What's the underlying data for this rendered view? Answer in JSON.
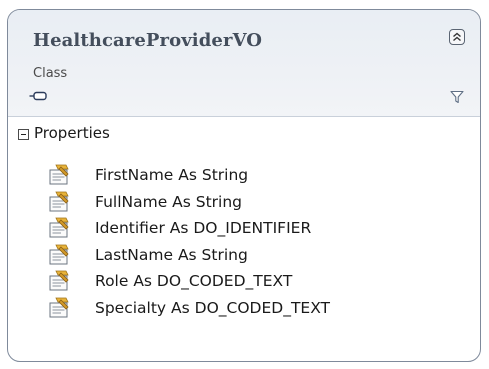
{
  "class_shape": {
    "name": "HealthcareProviderVO",
    "stereotype": "Class",
    "icons": {
      "collapse": "double-chevron-up-icon",
      "inheritance": "inheritance-lollipop-icon",
      "filter": "filter-icon"
    }
  },
  "compartment": {
    "title": "Properties",
    "toggle_icon": "minus-box-icon",
    "items": [
      {
        "label": "FirstName As String",
        "icon": "property-icon"
      },
      {
        "label": "FullName As String",
        "icon": "property-icon"
      },
      {
        "label": "Identifier As DO_IDENTIFIER",
        "icon": "property-icon"
      },
      {
        "label": "LastName As String",
        "icon": "property-icon"
      },
      {
        "label": "Role As DO_CODED_TEXT",
        "icon": "property-icon"
      },
      {
        "label": "Specialty As DO_CODED_TEXT",
        "icon": "property-icon"
      }
    ]
  },
  "colors": {
    "border": "#7f8a9b",
    "header_bg": "#eef1f5",
    "title_text": "#444e5c"
  }
}
